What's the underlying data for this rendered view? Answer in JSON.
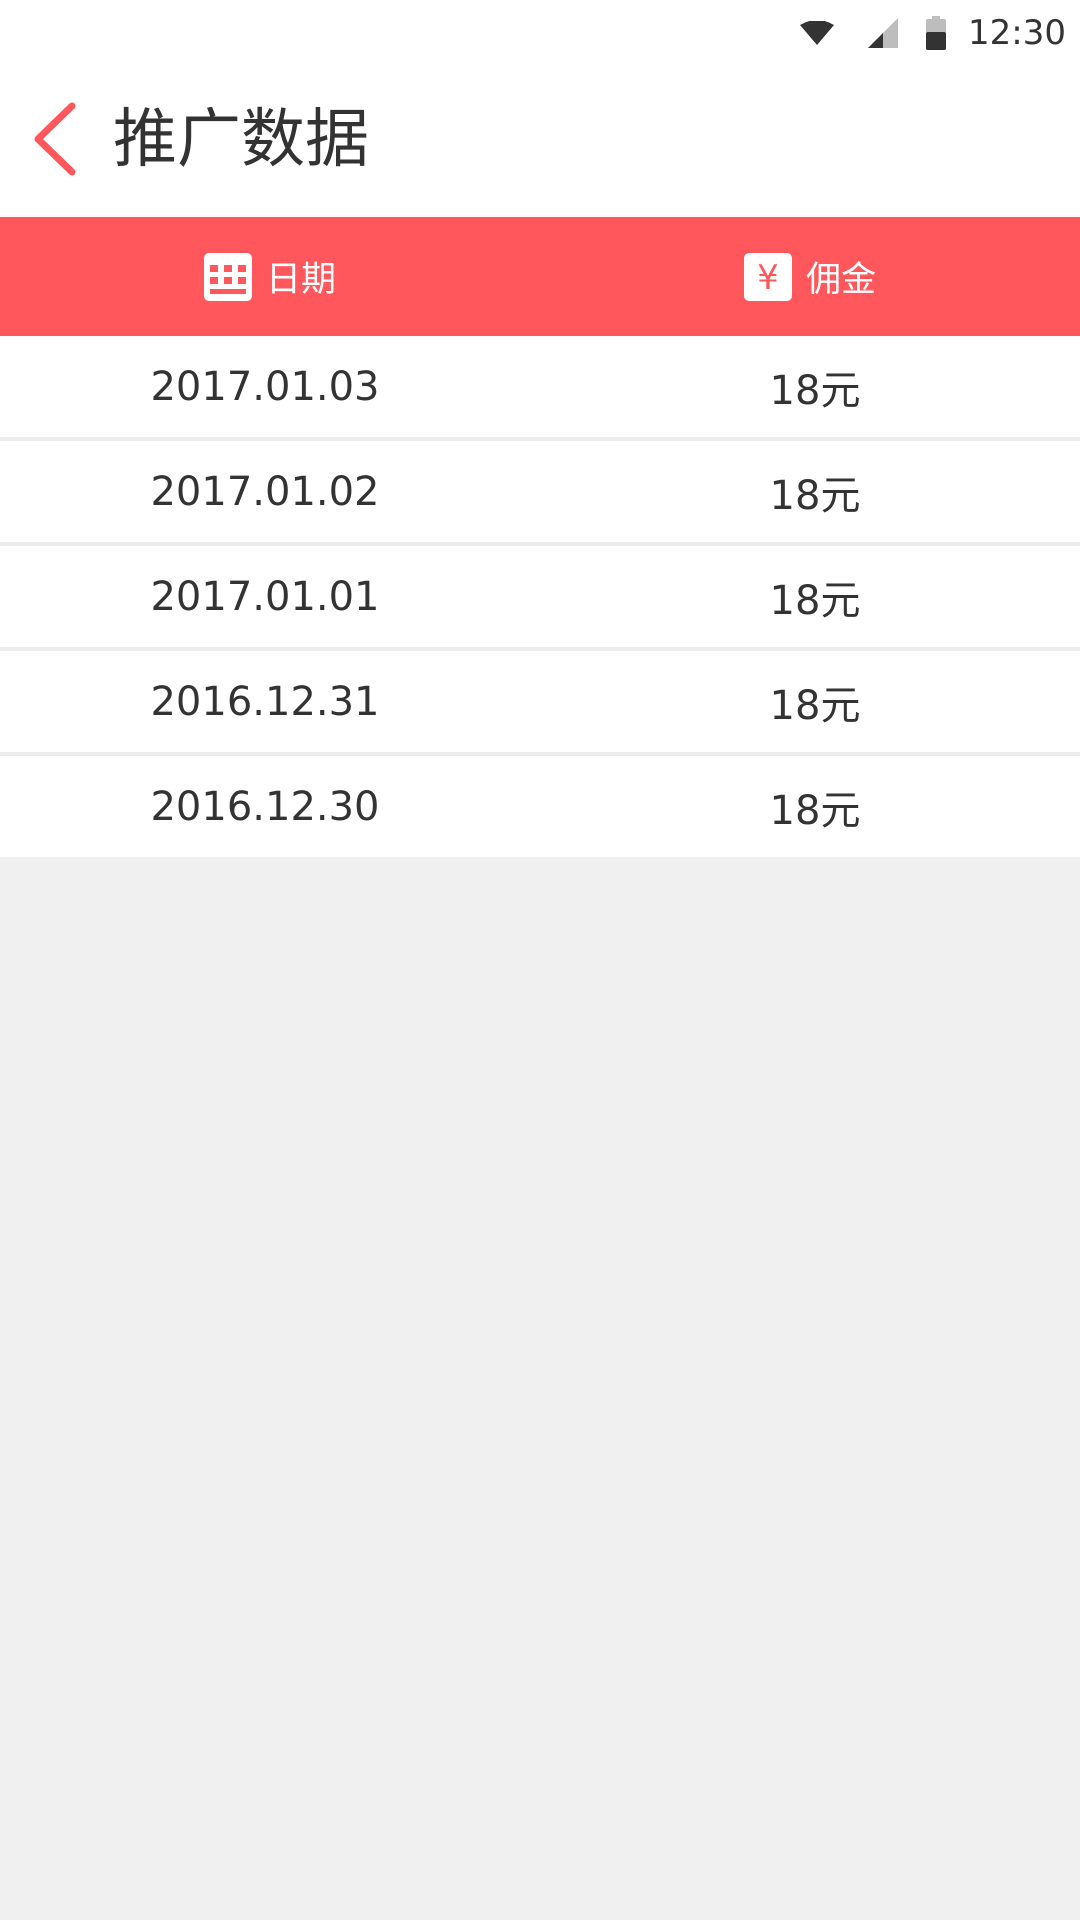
{
  "status_bar": {
    "time": "12:30",
    "icons": [
      "wifi-icon",
      "signal-icon",
      "battery-icon"
    ]
  },
  "app_bar": {
    "title": "推广数据",
    "back_icon": "chevron-left-icon"
  },
  "table": {
    "columns": [
      {
        "label": "日期",
        "icon": "calendar-icon"
      },
      {
        "label": "佣金",
        "icon": "yen-icon"
      }
    ],
    "rows": [
      {
        "date": "2017.01.03",
        "amount": "18元"
      },
      {
        "date": "2017.01.02",
        "amount": "18元"
      },
      {
        "date": "2017.01.01",
        "amount": "18元"
      },
      {
        "date": "2016.12.31",
        "amount": "18元"
      },
      {
        "date": "2016.12.30",
        "amount": "18元"
      }
    ]
  },
  "colors": {
    "accent": "#ff575b",
    "background": "#f0f0f0",
    "text": "#333333"
  }
}
